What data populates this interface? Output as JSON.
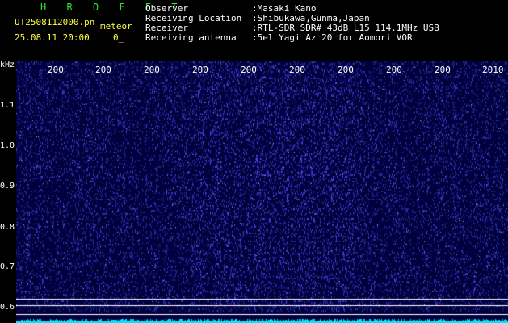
{
  "header": {
    "app_title": "H R O F F T",
    "filename": "UT2508112000.pn",
    "mode": "meteor",
    "date": "25.08.11 20:00",
    "counter": "0_",
    "labels": [
      "Observer",
      "Receiving Location",
      "Receiver",
      "Receiving antenna"
    ],
    "values": [
      ":Masaki Kano",
      ":Shibukawa,Gunma,Japan",
      ":RTL-SDR SDR# 43dB L15 114.1MHz USB",
      ":5el Yagi Az 20 for Aomori VOR"
    ]
  },
  "axis": {
    "unit": "kHz",
    "y_ticks": [
      "1.1",
      "1.0",
      "0.9",
      "0.8",
      "0.7",
      "0.6"
    ],
    "x_ticks": [
      "200",
      "200",
      "200",
      "200",
      "200",
      "200",
      "200",
      "200",
      "200",
      "2010"
    ]
  },
  "colors": {
    "background": "#00003c",
    "signal": "#00e5ff",
    "grid": "#ffffff"
  }
}
